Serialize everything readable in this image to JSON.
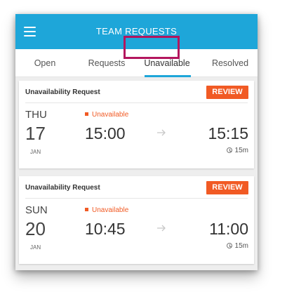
{
  "header": {
    "title": "TEAM REQUESTS",
    "menu_icon": "hamburger-menu-icon",
    "background_color": "#1ea6d9"
  },
  "tabs": [
    {
      "label": "Open",
      "active": false
    },
    {
      "label": "Requests",
      "active": false
    },
    {
      "label": "Unavailable",
      "active": true
    },
    {
      "label": "Resolved",
      "active": false
    }
  ],
  "highlight_color": "#b3165e",
  "accent_color": "#f15a24",
  "requests": [
    {
      "title": "Unavailability Request",
      "action_label": "REVIEW",
      "day_of_week": "THU",
      "day": "17",
      "month": "JAN",
      "status": "Unavailable",
      "start_time": "15:00",
      "end_time": "15:15",
      "duration": "15m"
    },
    {
      "title": "Unavailability Request",
      "action_label": "REVIEW",
      "day_of_week": "SUN",
      "day": "20",
      "month": "JAN",
      "status": "Unavailable",
      "start_time": "10:45",
      "end_time": "11:00",
      "duration": "15m"
    }
  ]
}
